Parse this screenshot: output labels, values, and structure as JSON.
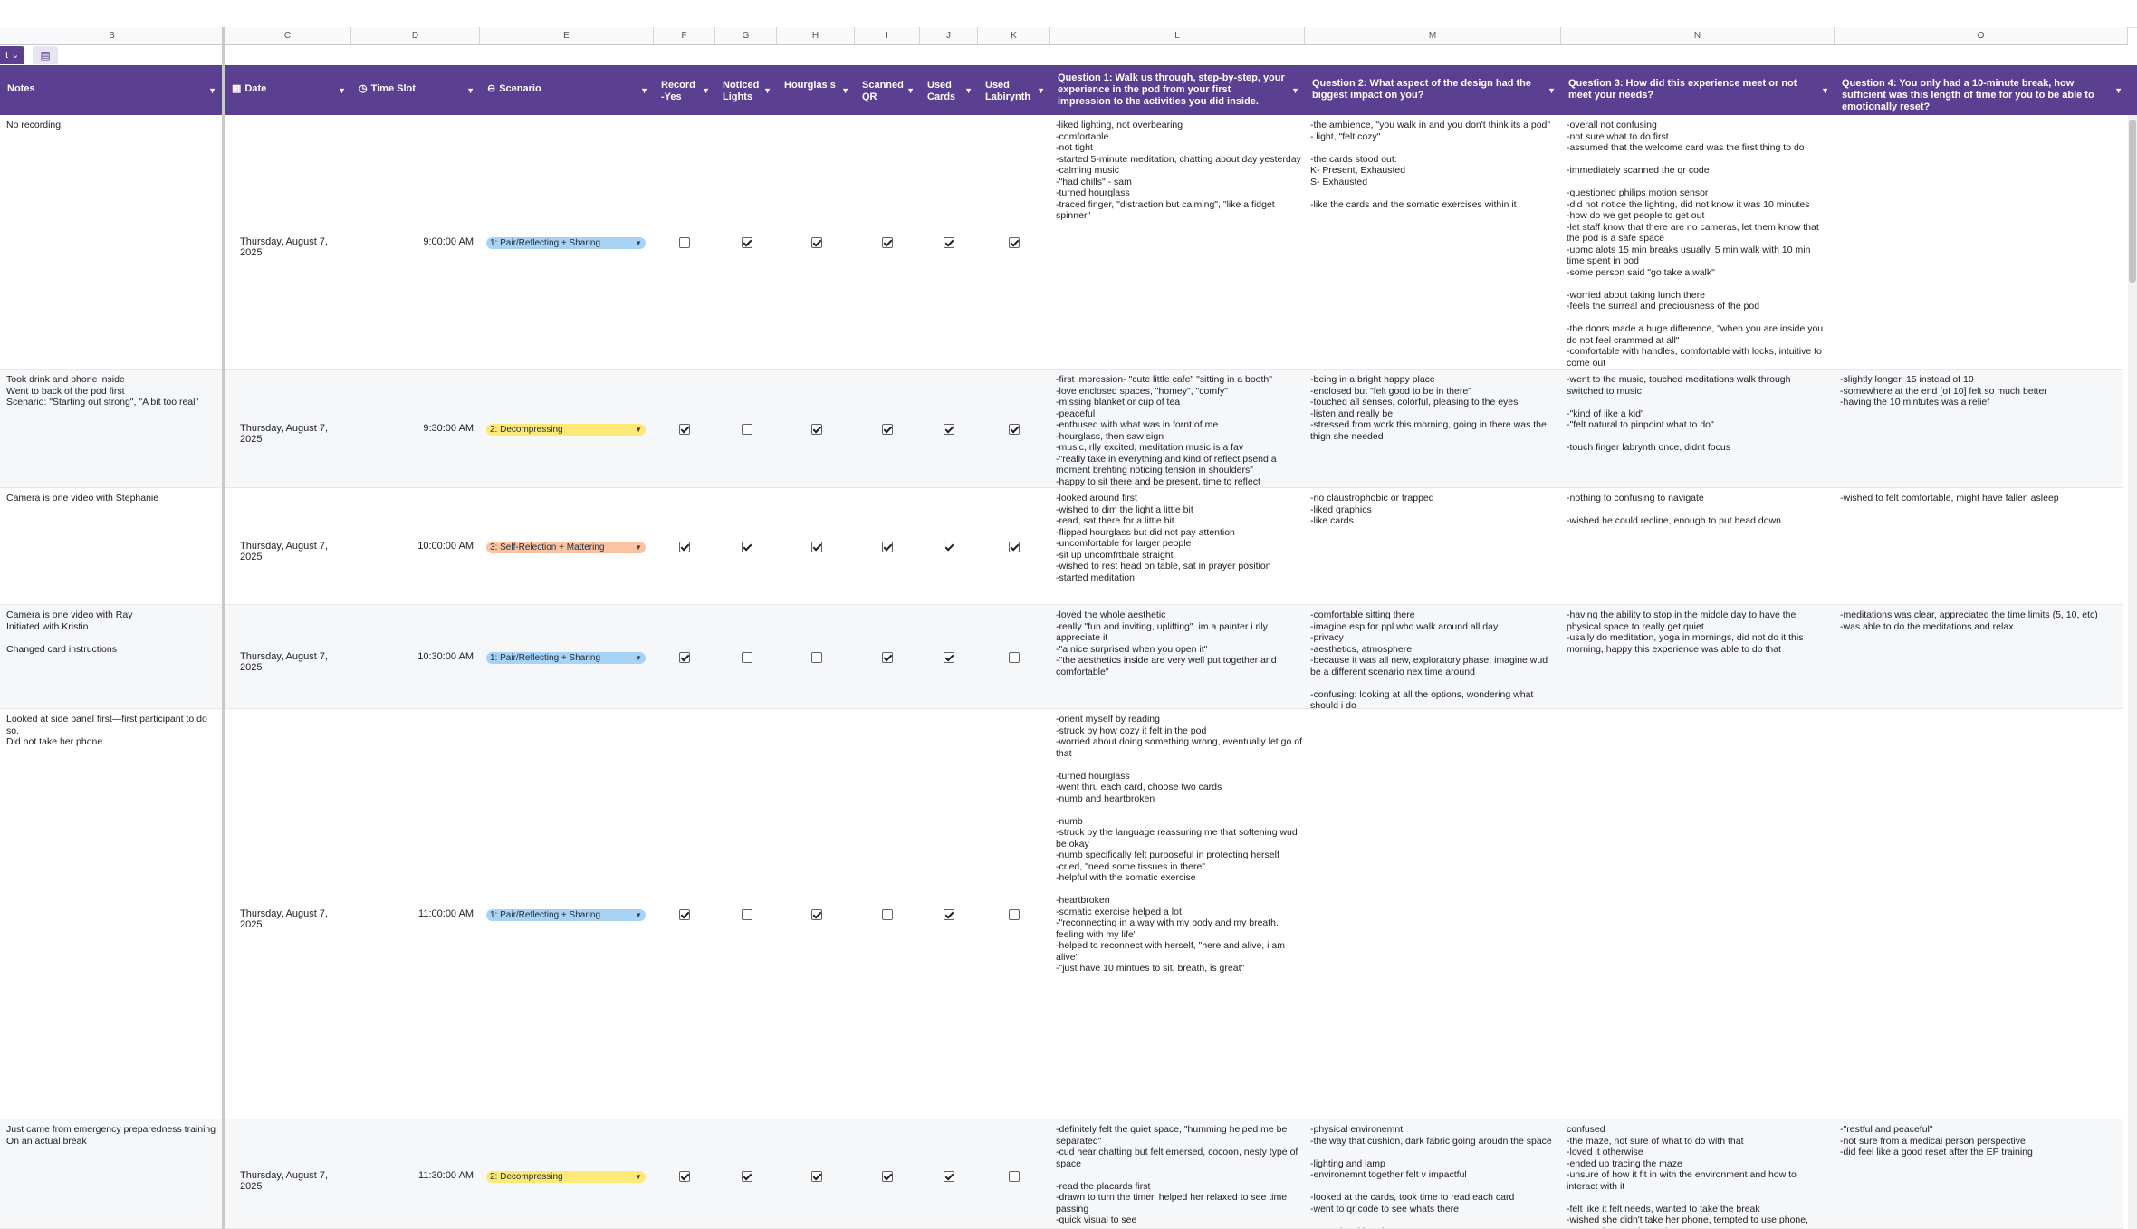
{
  "column_letters": [
    "B",
    "C",
    "D",
    "E",
    "F",
    "G",
    "H",
    "I",
    "J",
    "K",
    "L",
    "M",
    "N",
    "O"
  ],
  "tabs": {
    "active_label": "t",
    "active_caret": "⌄",
    "icon_glyph": "▤"
  },
  "headers": {
    "notes": "Notes",
    "date": "Date",
    "time_slot": "Time Slot",
    "scenario": "Scenario",
    "record": "Record -Yes",
    "noticed_lights": "Noticed Lights",
    "hourglass": "Hourglas s",
    "scanned_qr": "Scanned QR",
    "used_cards": "Used Cards",
    "used_labyrinth": "Used Labirynth",
    "q1": "Question 1: Walk us through, step-by-step, your experience in the pod from your first impression to the activities you did inside.",
    "q2": "Question 2: What aspect of the design had the biggest impact on you?",
    "q3": "Question 3: How did this experience meet or not meet your needs?",
    "q4": "Question 4: You only had a 10-minute break, how sufficient was this length of time for you to be able to emotionally reset?"
  },
  "icons": {
    "date": "calendar-icon",
    "time": "clock-icon",
    "scenario": "tag-icon",
    "dropdown": "chevron-down-icon"
  },
  "colors": {
    "header_bg": "#5b3f91",
    "chip_blue": "#a8d3f5",
    "chip_yellow": "#fde977",
    "chip_orange": "#f9c3a4"
  },
  "rows": [
    {
      "notes": "No recording",
      "date": "Thursday, August 7, 2025",
      "time": "9:00:00 AM",
      "scenario": "1: Pair/Reflecting + Sharing",
      "scenario_color": "blue",
      "checks": [
        false,
        true,
        true,
        true,
        true,
        true
      ],
      "q1": "-liked lighting, not overbearing\n-comfortable\n-not tight\n-started 5-minute meditation, chatting about day yesterday\n-calming music\n-\"had chills\" - sam\n-turned hourglass\n-traced finger, \"distraction but calming\", \"like a fidget spinner\"",
      "q2": "-the ambience, \"you walk in and you don't think its a pod\"\n- light, \"felt cozy\"\n\n-the cards stood out:\nK- Present, Exhausted\nS- Exhausted\n\n-like the cards and the somatic exercises within it",
      "q3": "-overall not confusing\n-not sure what to do first\n-assumed that the welcome card was the first thing to do\n\n-immediately scanned the qr code\n\n-questioned philips motion sensor\n-did not notice the lighting, did not know it was 10 minutes\n-how do we get people to get out\n-let staff know that there are no cameras, let them know that the pod is a safe space\n-upmc alots 15 min breaks usually, 5 min walk with 10 min time spent in pod\n-some person said \"go take a walk\"\n\n-worried about taking lunch there\n-feels the surreal and preciousness of the pod\n\n-the doors made a huge difference, \"when you are inside you do not feel crammed at all\"\n-comfortable with handles, comfortable with locks, intuitive to come out",
      "q4": ""
    },
    {
      "notes": "Took drink and phone inside\nWent to back of the pod first\nScenario: \"Starting out strong\", \"A bit too real\"",
      "date": "Thursday, August 7, 2025",
      "time": "9:30:00 AM",
      "scenario": "2: Decompressing",
      "scenario_color": "yellow",
      "checks": [
        true,
        false,
        true,
        true,
        true,
        true
      ],
      "q1": "-first impression- \"cute little cafe\" \"sitting in a booth\"\n-love enclosed spaces, \"homey\", \"comfy\"\n-missing blanket or cup of tea\n-peaceful\n-enthused with what was in fornt of me\n-hourglass, then saw sign\n-music, rlly excited, meditation music is a fav\n-\"really take in everything and kind of reflect psend a moment brehting noticing tension in shoulders\"\n-happy to sit there and be present, time to reflect",
      "q2": "-being in a bright happy place\n-enclosed but \"felt good to be in there\"\n-touched all senses, colorful, pleasing to the eyes\n-listen and really be\n-stressed from work this morning, going in there was the thign she needed",
      "q3": "-went to the music, touched meditations walk through switched to music\n\n-\"kind of like a kid\"\n-\"felt natural to pinpoint what to do\"\n\n-touch finger labrynth once, didnt focus",
      "q4": "-slightly longer, 15 instead of 10\n-somewhere at the end [of 10] felt so much better\n-having the 10 mintutes was a relief"
    },
    {
      "notes": "Camera is one video with Stephanie",
      "date": "Thursday, August 7, 2025",
      "time": "10:00:00 AM",
      "scenario": "3: Self-Relection + Mattering",
      "scenario_color": "orange",
      "checks": [
        true,
        true,
        true,
        true,
        true,
        true
      ],
      "q1": "-looked around first\n-wished to dim the light a little bit\n-read, sat there for a little bit\n-flipped hourglass but did not pay attention\n-uncomfortable for larger people\n-sit up uncomfrtbale straight\n-wished to rest head on table, sat in prayer position\n-started meditation",
      "q2": "-no claustrophobic or trapped\n-liked graphics\n-like cards",
      "q3": "-nothing to confusing to navigate\n\n-wished he could recline, enough to put head down",
      "q4": "-wished to felt comfortable, might have fallen asleep"
    },
    {
      "notes": "Camera is one video with Ray\nInitiated with Kristin\n\nChanged card instructions",
      "date": "Thursday, August 7, 2025",
      "time": "10:30:00 AM",
      "scenario": "1: Pair/Reflecting + Sharing",
      "scenario_color": "blue",
      "checks": [
        true,
        false,
        false,
        true,
        true,
        false
      ],
      "q1": "-loved the whole aesthetic\n-really \"fun and inviting, uplifting\". im a painter i rlly appreciate it\n-\"a nice surprised when you open it\"\n-\"the aesthetics inside are very well put together and comfortable\"",
      "q2": "-comfortable sitting there\n-imagine esp for ppl who walk around all day\n-privacy\n-aesthetics, atmosphere\n-because it was all new, exploratory phase; imagine wud be a different scenario nex time around\n\n-confusing: looking at all the options, wondering what should i do",
      "q3": "-having the ability to stop in the middle day to have the physical space to really get quiet\n-usally do meditation, yoga in mornings, did not do it this morning, happy this experience was able to do that",
      "q4": "-meditations was clear, appreciated the time limits (5, 10, etc)\n-was able to do the meditations and relax"
    },
    {
      "notes": "Looked at side panel first—first participant to do so.\nDid not take her phone.",
      "date": "Thursday, August 7, 2025",
      "time": "11:00:00 AM",
      "scenario": "1: Pair/Reflecting + Sharing",
      "scenario_color": "blue",
      "checks": [
        true,
        false,
        true,
        false,
        true,
        false
      ],
      "q1": "-orient myself by reading\n-struck by how cozy it felt in the pod\n-worried about doing something wrong, eventually let go of that\n\n-turned hourglass\n-went thru each card, choose two cards\n-numb and heartbroken\n\n-numb\n-struck by the language reassuring me that softening wud be okay\n-numb specifically felt purposeful in protecting herself\n-cried, \"need some tissues in there\"\n-helpful with the somatic exercise\n\n-heartbroken\n-somatic exercise helped a lot\n-\"reconnecting in a way with my body and my breath. feeling with my life\"\n-helped to reconnect with herself, \"here and alive, i am alive\"\n-\"just have 10 mintues to sit, breath, is great\"",
      "q2": "",
      "q3": "",
      "q4": ""
    },
    {
      "notes": "Just came from emergency preparedness training\nOn an actual break",
      "date": "Thursday, August 7, 2025",
      "time": "11:30:00 AM",
      "scenario": "2: Decompressing",
      "scenario_color": "yellow",
      "checks": [
        true,
        true,
        true,
        true,
        true,
        false
      ],
      "q1": "-definitely felt the quiet space, \"humming helped me be separated\"\n-cud hear chatting but felt emersed, cocoon, nesty type of space\n\n-read the placards first\n-drawn to turn the timer, helped her relaxed to see time passing\n-quick visual to see",
      "q2": "-physical environemnt\n-the way that cushion, dark fabric going aroudn the space\n\n-lighting and lamp\n-environemnt together felt v impactful\n\n-looked at the cards, took time to read each card\n-went to qr code to see whats there\n\n-\"intentional break\"",
      "q3": "confused\n-the maze, not sure of what to do with that\n-loved it otherwise\n-ended up tracing the maze\n-unsure of how it fit in with the environment and how to interact with it\n\n-felt like it felt needs, wanted to take the break\n-wished she didn't take her phone, tempted to use phone, prepared text at the end",
      "q4": "-\"restful and peaceful\"\n-not sure from a medical person perspective\n-did feel like a good reset after the EP training"
    }
  ]
}
